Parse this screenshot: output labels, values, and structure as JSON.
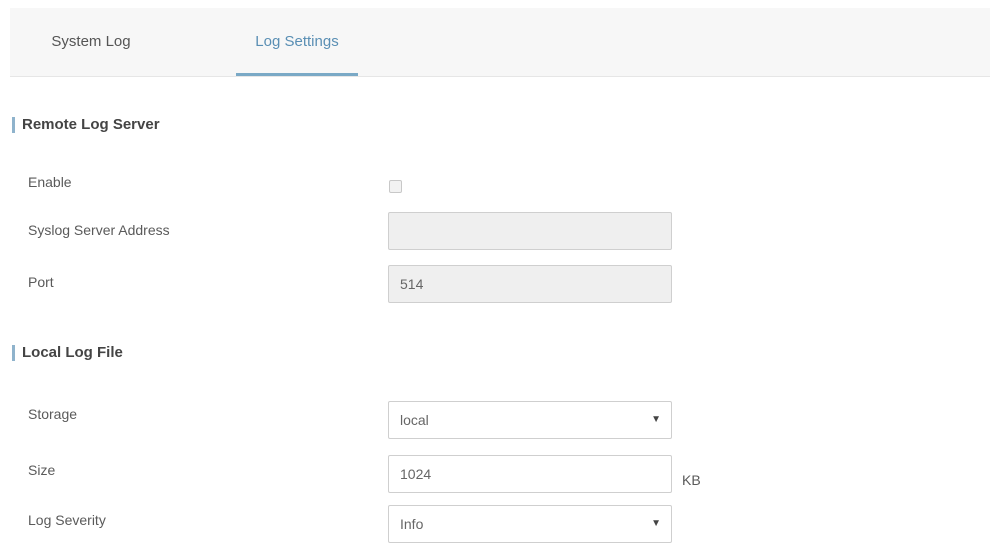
{
  "tabs": [
    {
      "label": "System Log",
      "active": false
    },
    {
      "label": "Log Settings",
      "active": true
    }
  ],
  "remote_log_server": {
    "title": "Remote Log Server",
    "enable": {
      "label": "Enable",
      "checked": false
    },
    "syslog_server_address": {
      "label": "Syslog Server Address",
      "value": ""
    },
    "port": {
      "label": "Port",
      "value": "514"
    }
  },
  "local_log_file": {
    "title": "Local Log File",
    "storage": {
      "label": "Storage",
      "value": "local"
    },
    "size": {
      "label": "Size",
      "value": "1024",
      "unit": "KB"
    },
    "log_severity": {
      "label": "Log Severity",
      "value": "Info"
    }
  },
  "colors": {
    "accent": "#5a8fb4",
    "tab_underline": "#7aa9c6",
    "section_marker": "#8fb3cc",
    "disabled_field_bg": "#efefef"
  },
  "icons": {
    "dropdown": "caret-down-icon"
  }
}
